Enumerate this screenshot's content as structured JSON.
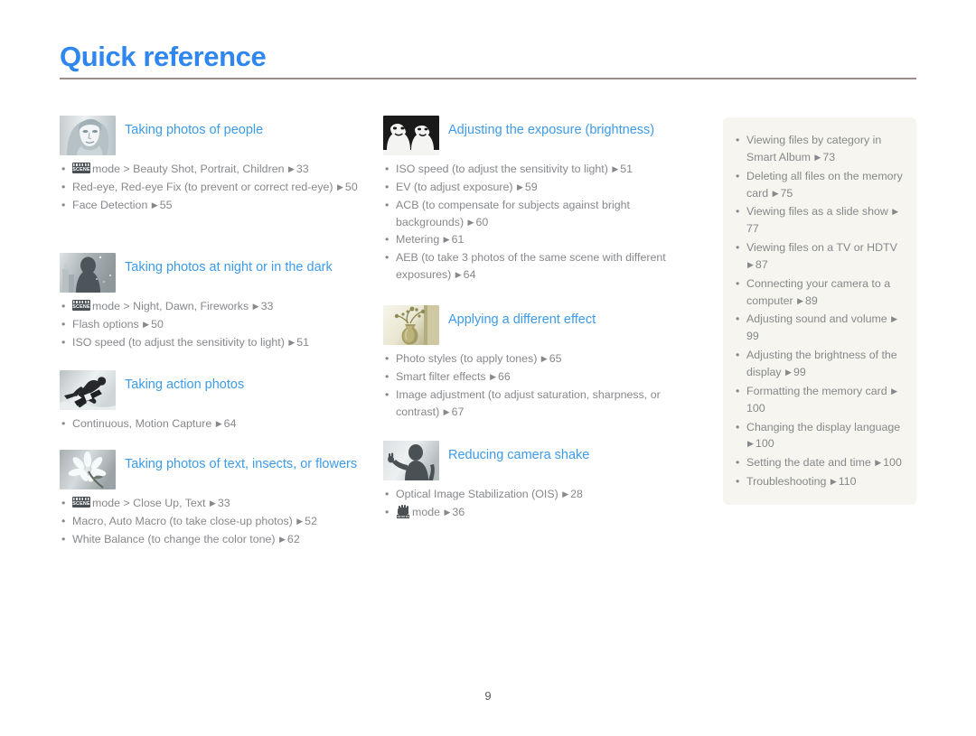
{
  "header": {
    "title": "Quick reference",
    "rule_color": "#9c8e8a",
    "title_color": "#2f86ef"
  },
  "footer": {
    "page_number": "9"
  },
  "colors": {
    "heading_blue": "#3d9be9",
    "body_gray": "#86888b",
    "panel_bg": "#f6f5ef"
  },
  "columns": [
    {
      "id": "column-left",
      "sections": [
        {
          "id": "taking-photos-of-people",
          "icon": "portrait-woman-thumbnail",
          "title": "Taking photos of people",
          "items": [
            {
              "icon": "scene-mode-icon",
              "text": "mode > Beauty Shot, Portrait, Children",
              "arrow": "▶",
              "page": "33"
            },
            {
              "text": "Red-eye, Red-eye Fix (to prevent or correct red-eye)",
              "arrow": "▶",
              "page": "50"
            },
            {
              "text": "Face Detection",
              "arrow": "▶",
              "page": "55"
            }
          ]
        },
        {
          "id": "taking-photos-at-night",
          "icon": "night-scene-thumbnail",
          "title": "Taking photos at night or in the dark",
          "items": [
            {
              "icon": "scene-mode-icon",
              "text": "mode > Night, Dawn, Fireworks",
              "arrow": "▶",
              "page": "33"
            },
            {
              "text": "Flash options",
              "arrow": "▶",
              "page": "50"
            },
            {
              "text": "ISO speed (to adjust the sensitivity to light)",
              "arrow": "▶",
              "page": "51"
            }
          ]
        },
        {
          "id": "taking-action-photos",
          "icon": "snowboarder-thumbnail",
          "title": "Taking action photos",
          "items": [
            {
              "text": "Continuous, Motion Capture",
              "arrow": "▶",
              "page": "64"
            }
          ]
        },
        {
          "id": "taking-photos-of-text",
          "icon": "flower-thumbnail",
          "title": "Taking photos of text, insects, or flowers",
          "items": [
            {
              "icon": "scene-mode-icon",
              "text": "mode > Close Up, Text",
              "arrow": "▶",
              "page": "33"
            },
            {
              "text": "Macro, Auto Macro (to take close-up photos)",
              "arrow": "▶",
              "page": "52"
            },
            {
              "text": "White Balance (to change the color tone)",
              "arrow": "▶",
              "page": "62"
            }
          ]
        }
      ]
    },
    {
      "id": "column-middle",
      "sections": [
        {
          "id": "adjusting-the-exposure",
          "icon": "two-faces-thumbnail",
          "title": "Adjusting the exposure (brightness)",
          "items": [
            {
              "text": "ISO speed (to adjust the sensitivity to light)",
              "arrow": "▶",
              "page": "51"
            },
            {
              "text": "EV (to adjust exposure)",
              "arrow": "▶",
              "page": "59"
            },
            {
              "text": "ACB (to compensate for subjects against bright backgrounds)",
              "arrow": "▶",
              "page": "60"
            },
            {
              "text": "Metering",
              "arrow": "▶",
              "page": "61"
            },
            {
              "text": "AEB (to take 3 photos of the same scene with different exposures)",
              "arrow": "▶",
              "page": "64"
            }
          ]
        },
        {
          "id": "applying-a-different-effect",
          "icon": "vase-flowers-thumbnail",
          "title": "Applying a different effect",
          "items": [
            {
              "text": "Photo styles (to apply tones)",
              "arrow": "▶",
              "page": "65"
            },
            {
              "text": "Smart filter effects",
              "arrow": "▶",
              "page": "66"
            },
            {
              "text": "Image adjustment (to adjust saturation, sharpness, or contrast)",
              "arrow": "▶",
              "page": "67"
            }
          ]
        },
        {
          "id": "reducing-camera-shake",
          "icon": "person-waving-thumbnail",
          "title": "Reducing camera shake",
          "items": [
            {
              "text": "Optical Image Stabilization (OIS)",
              "arrow": "▶",
              "page": "28"
            },
            {
              "icon": "dual-is-hand-icon",
              "text": "mode",
              "arrow": "▶",
              "page": "36"
            }
          ]
        }
      ]
    }
  ],
  "side_panel": {
    "id": "side-panel",
    "items": [
      {
        "text": "Viewing files by category in Smart Album",
        "arrow": "▶",
        "page": "73"
      },
      {
        "text": "Deleting all files on the memory card",
        "arrow": "▶",
        "page": "75"
      },
      {
        "text": "Viewing files as a slide show",
        "arrow": "▶",
        "page": "77"
      },
      {
        "text": "Viewing files on a TV or HDTV",
        "arrow": "▶",
        "page": "87"
      },
      {
        "text": "Connecting your camera to a computer",
        "arrow": "▶",
        "page": "89"
      },
      {
        "text": "Adjusting sound and volume",
        "arrow": "▶",
        "page": "99"
      },
      {
        "text": "Adjusting the brightness of the display",
        "arrow": "▶",
        "page": "99"
      },
      {
        "text": "Formatting the memory card",
        "arrow": "▶",
        "page": "100"
      },
      {
        "text": "Changing the display language",
        "arrow": "▶",
        "page": "100"
      },
      {
        "text": "Setting the date and time",
        "arrow": "▶",
        "page": "100"
      },
      {
        "text": "Troubleshooting",
        "arrow": "▶",
        "page": "110"
      }
    ]
  }
}
